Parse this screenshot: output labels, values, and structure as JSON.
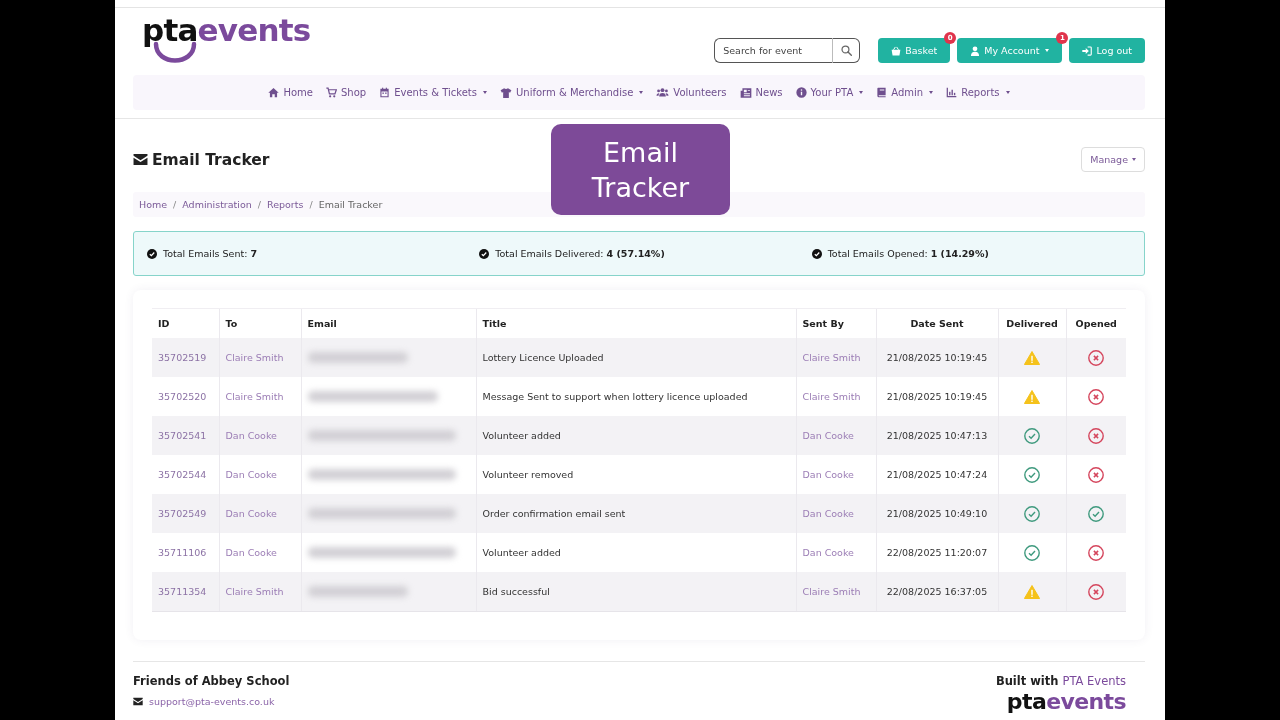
{
  "header": {
    "logo": {
      "dark": "pta",
      "accent": "events"
    },
    "search": {
      "placeholder": "Search for event"
    },
    "buttons": [
      {
        "label": "Basket",
        "badge": "0",
        "has_menu": false
      },
      {
        "label": "My Account",
        "badge": "1",
        "has_menu": true
      },
      {
        "label": "Log out",
        "has_menu": false
      }
    ]
  },
  "nav": {
    "items": [
      {
        "label": "Home",
        "has_menu": false
      },
      {
        "label": "Shop",
        "has_menu": false
      },
      {
        "label": "Events & Tickets",
        "has_menu": true
      },
      {
        "label": "Uniform & Merchandise",
        "has_menu": true
      },
      {
        "label": "Volunteers",
        "has_menu": false
      },
      {
        "label": "News",
        "has_menu": false
      },
      {
        "label": "Your PTA",
        "has_menu": true
      },
      {
        "label": "Admin",
        "has_menu": true
      },
      {
        "label": "Reports",
        "has_menu": true
      }
    ]
  },
  "page": {
    "title": "Email Tracker",
    "manage_button": {
      "label": "Manage",
      "has_menu": true
    }
  },
  "caption_overlay": {
    "text": "Email Tracker"
  },
  "breadcrumb": {
    "separator": "/",
    "items": [
      {
        "label": "Home",
        "current": false
      },
      {
        "label": "Administration",
        "current": false
      },
      {
        "label": "Reports",
        "current": false
      },
      {
        "label": "Email Tracker",
        "current": true
      }
    ]
  },
  "summary": [
    "Total Emails Sent: **7**",
    "Total Emails Delivered: **4 (57.14%)**",
    "Total Emails Opened: **1 (14.29%)**"
  ],
  "table": {
    "columns": [
      "ID",
      "To",
      "Email",
      "Title",
      "Sent By",
      "Date Sent",
      "Delivered",
      "Opened"
    ],
    "rows": [
      {
        "id": "35702519",
        "to": "Claire Smith",
        "title": "Lottery Licence Uploaded",
        "sent_by": "Claire Smith",
        "date_sent": "21/08/2025 10:19:45",
        "delivered": false,
        "opened": false
      },
      {
        "id": "35702520",
        "to": "Claire Smith",
        "title": "Message Sent to support when lottery licence uploaded",
        "sent_by": "Claire Smith",
        "date_sent": "21/08/2025 10:19:45",
        "delivered": false,
        "opened": false
      },
      {
        "id": "35702541",
        "to": "Dan Cooke",
        "title": "Volunteer added",
        "sent_by": "Dan Cooke",
        "date_sent": "21/08/2025 10:47:13",
        "delivered": true,
        "opened": false
      },
      {
        "id": "35702544",
        "to": "Dan Cooke",
        "title": "Volunteer removed",
        "sent_by": "Dan Cooke",
        "date_sent": "21/08/2025 10:47:24",
        "delivered": true,
        "opened": false
      },
      {
        "id": "35702549",
        "to": "Dan Cooke",
        "title": "Order confirmation email sent",
        "sent_by": "Dan Cooke",
        "date_sent": "21/08/2025 10:49:10",
        "delivered": true,
        "opened": true
      },
      {
        "id": "35711106",
        "to": "Dan Cooke",
        "title": "Volunteer added",
        "sent_by": "Dan Cooke",
        "date_sent": "22/08/2025 11:20:07",
        "delivered": true,
        "opened": false
      },
      {
        "id": "35711354",
        "to": "Claire Smith",
        "title": "Bid successful",
        "sent_by": "Claire Smith",
        "date_sent": "22/08/2025 16:37:05",
        "delivered": false,
        "opened": false
      }
    ]
  },
  "footer": {
    "organisation": "Friends of Abbey School",
    "email": "support@pta-events.co.uk",
    "built_with": "Built with",
    "built_with_link": "PTA Events",
    "logo": {
      "dark": "pta",
      "accent": "events"
    }
  }
}
